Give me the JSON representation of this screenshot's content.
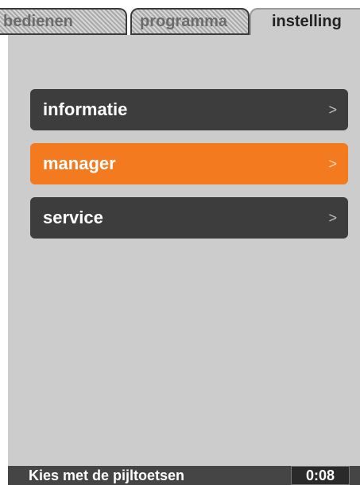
{
  "tabs": [
    {
      "label": "bedienen",
      "active": false
    },
    {
      "label": "programma",
      "active": false
    },
    {
      "label": "instelling",
      "active": true
    }
  ],
  "menu": {
    "items": [
      {
        "label": "informatie",
        "chevron": ">",
        "selected": false
      },
      {
        "label": "manager",
        "chevron": ">",
        "selected": true
      },
      {
        "label": "service",
        "chevron": ">",
        "selected": false
      }
    ]
  },
  "status": {
    "hint": "Kies met de pijltoetsen",
    "timer": "0:08"
  },
  "colors": {
    "selected_accent": "#f47a1f",
    "item_background": "#3d3d3d",
    "panel_background": "#cccccc"
  }
}
